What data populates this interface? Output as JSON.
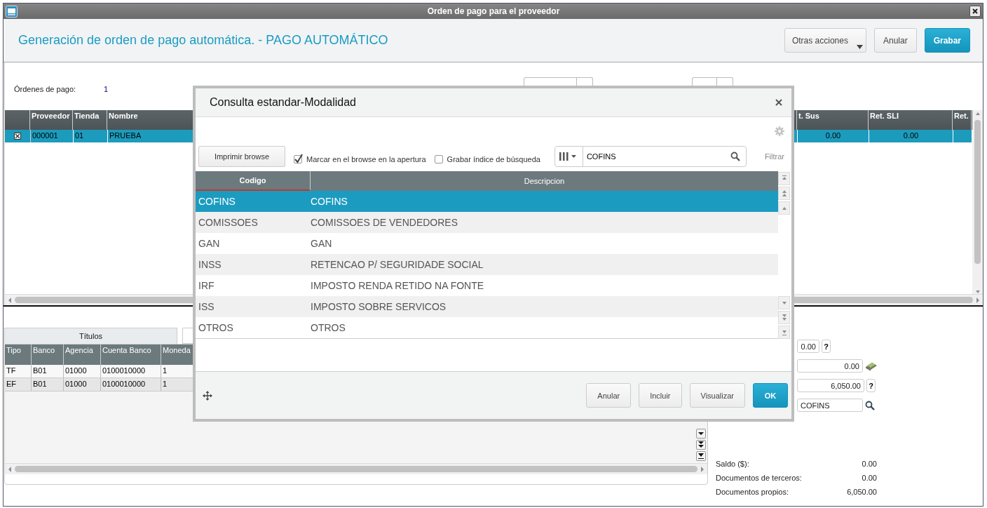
{
  "window": {
    "title": "Orden de pago para el proveedor"
  },
  "header": {
    "title": "Generación de orden de pago automática. - PAGO AUTOMÁTICO",
    "actions": [
      {
        "label": "Otras acciones",
        "kind": "menu"
      },
      {
        "label": "Anular",
        "kind": "default"
      },
      {
        "label": "Grabar",
        "kind": "primary"
      }
    ]
  },
  "summary": {
    "label": "Órdenes de pago:",
    "value": "1"
  },
  "top_grid": {
    "columns": [
      "Proveedor",
      "Tienda",
      "Nombre",
      "t. Sus",
      "Ret. SLI",
      "Ret."
    ],
    "rows": [
      {
        "selected": true,
        "checked": true,
        "cells": [
          "000001",
          "01",
          "PRUEBA",
          "0.00",
          "0.00",
          ""
        ]
      }
    ]
  },
  "tabs": [
    {
      "label": "Títulos",
      "selected": true
    },
    {
      "selected": false
    }
  ],
  "bottom_grid": {
    "columns": [
      "Tipo",
      "Banco",
      "Agencia",
      "Cuenta Banco",
      "Moneda"
    ],
    "rows": [
      {
        "cells": [
          "TF",
          "B01",
          "01000",
          "0100010000",
          "1"
        ]
      },
      {
        "cells": [
          "EF",
          "B01",
          "01000",
          "0100010000",
          "1"
        ]
      }
    ]
  },
  "right_fields": [
    {
      "value": "0.00",
      "kind": "help",
      "button": "?"
    },
    {
      "value": "0.00",
      "kind": "money"
    },
    {
      "value": "6,050.00",
      "kind": "help",
      "button": "?"
    },
    {
      "value": "COFINS",
      "kind": "search"
    }
  ],
  "totals": [
    {
      "label": "Saldo ($):",
      "value": "0.00"
    },
    {
      "label": "Documentos de terceros:",
      "value": "0.00"
    },
    {
      "label": "Documentos propios:",
      "value": "6,050.00"
    }
  ],
  "dialog": {
    "title": "Consulta estandar-Modalidad",
    "print_button": "Imprimir browse",
    "options": [
      {
        "label": "Marcar en el browse en la apertura",
        "checked": true
      },
      {
        "label": "Grabar índice de búsqueda",
        "checked": false
      }
    ],
    "search": {
      "value": "COFINS"
    },
    "filter_link": "Filtrar",
    "table": {
      "columns": [
        "Codigo",
        "Descripcion"
      ],
      "rows": [
        {
          "selected": true,
          "cells": [
            "COFINS",
            "COFINS"
          ]
        },
        {
          "selected": false,
          "cells": [
            "COMISSOES",
            "COMISSOES DE VENDEDORES"
          ]
        },
        {
          "selected": false,
          "cells": [
            "GAN",
            "GAN"
          ]
        },
        {
          "selected": false,
          "cells": [
            "INSS",
            "RETENCAO P/ SEGURIDADE SOCIAL"
          ]
        },
        {
          "selected": false,
          "cells": [
            "IRF",
            "IMPOSTO RENDA RETIDO NA FONTE"
          ]
        },
        {
          "selected": false,
          "cells": [
            "ISS",
            "IMPOSTO SOBRE SERVICOS"
          ]
        },
        {
          "selected": false,
          "cells": [
            "OTROS",
            "OTROS"
          ]
        }
      ]
    },
    "buttons": [
      {
        "label": "Anular",
        "kind": "default"
      },
      {
        "label": "Incluir",
        "kind": "default"
      },
      {
        "label": "Visualizar",
        "kind": "default"
      },
      {
        "label": "OK",
        "kind": "primary"
      }
    ]
  }
}
